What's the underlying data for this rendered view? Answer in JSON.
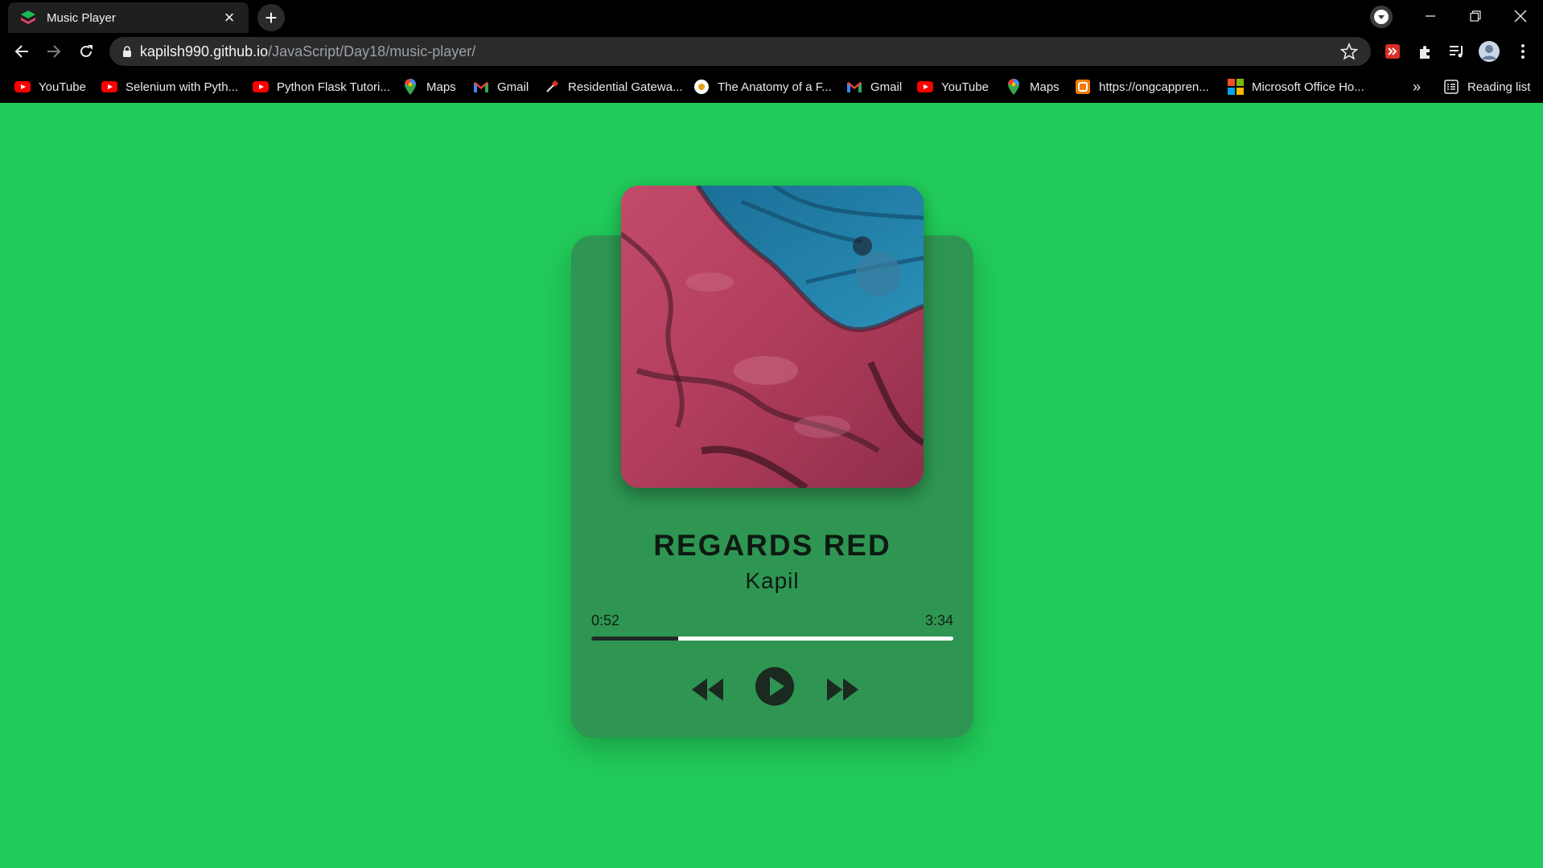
{
  "browser": {
    "tab": {
      "title": "Music Player"
    },
    "address": {
      "host": "kapilsh990.github.io",
      "path": "/JavaScript/Day18/music-player/"
    },
    "bookmarks": [
      {
        "label": "YouTube",
        "icon": "youtube-icon"
      },
      {
        "label": "Selenium with Pyth...",
        "icon": "youtube-icon"
      },
      {
        "label": "Python Flask Tutori...",
        "icon": "youtube-icon"
      },
      {
        "label": "Maps",
        "icon": "maps-pin-icon"
      },
      {
        "label": "Gmail",
        "icon": "gmail-icon"
      },
      {
        "label": "Residential Gatewa...",
        "icon": "tool-icon"
      },
      {
        "label": "The Anatomy of a F...",
        "icon": "circle-logo-icon"
      },
      {
        "label": "Gmail",
        "icon": "gmail-icon"
      },
      {
        "label": "YouTube",
        "icon": "youtube-icon"
      },
      {
        "label": "Maps",
        "icon": "maps-pin-icon"
      },
      {
        "label": "https://ongcappren...",
        "icon": "orange-site-icon"
      },
      {
        "label": "Microsoft Office Ho...",
        "icon": "microsoft-icon"
      }
    ],
    "bookmarks_overflow": "»",
    "reading_list": "Reading list"
  },
  "player": {
    "title": "REGARDS RED",
    "artist": "Kapil",
    "current_time": "0:52",
    "duration": "3:34",
    "progress_fraction": 0.24
  },
  "colors": {
    "page_background": "#21cb5a",
    "card_background": "#2e9652",
    "progress_track": "#ffffff",
    "progress_fill": "#1c2a21",
    "cover_pink": "#b8435f",
    "cover_blue": "#1e7fa8"
  }
}
